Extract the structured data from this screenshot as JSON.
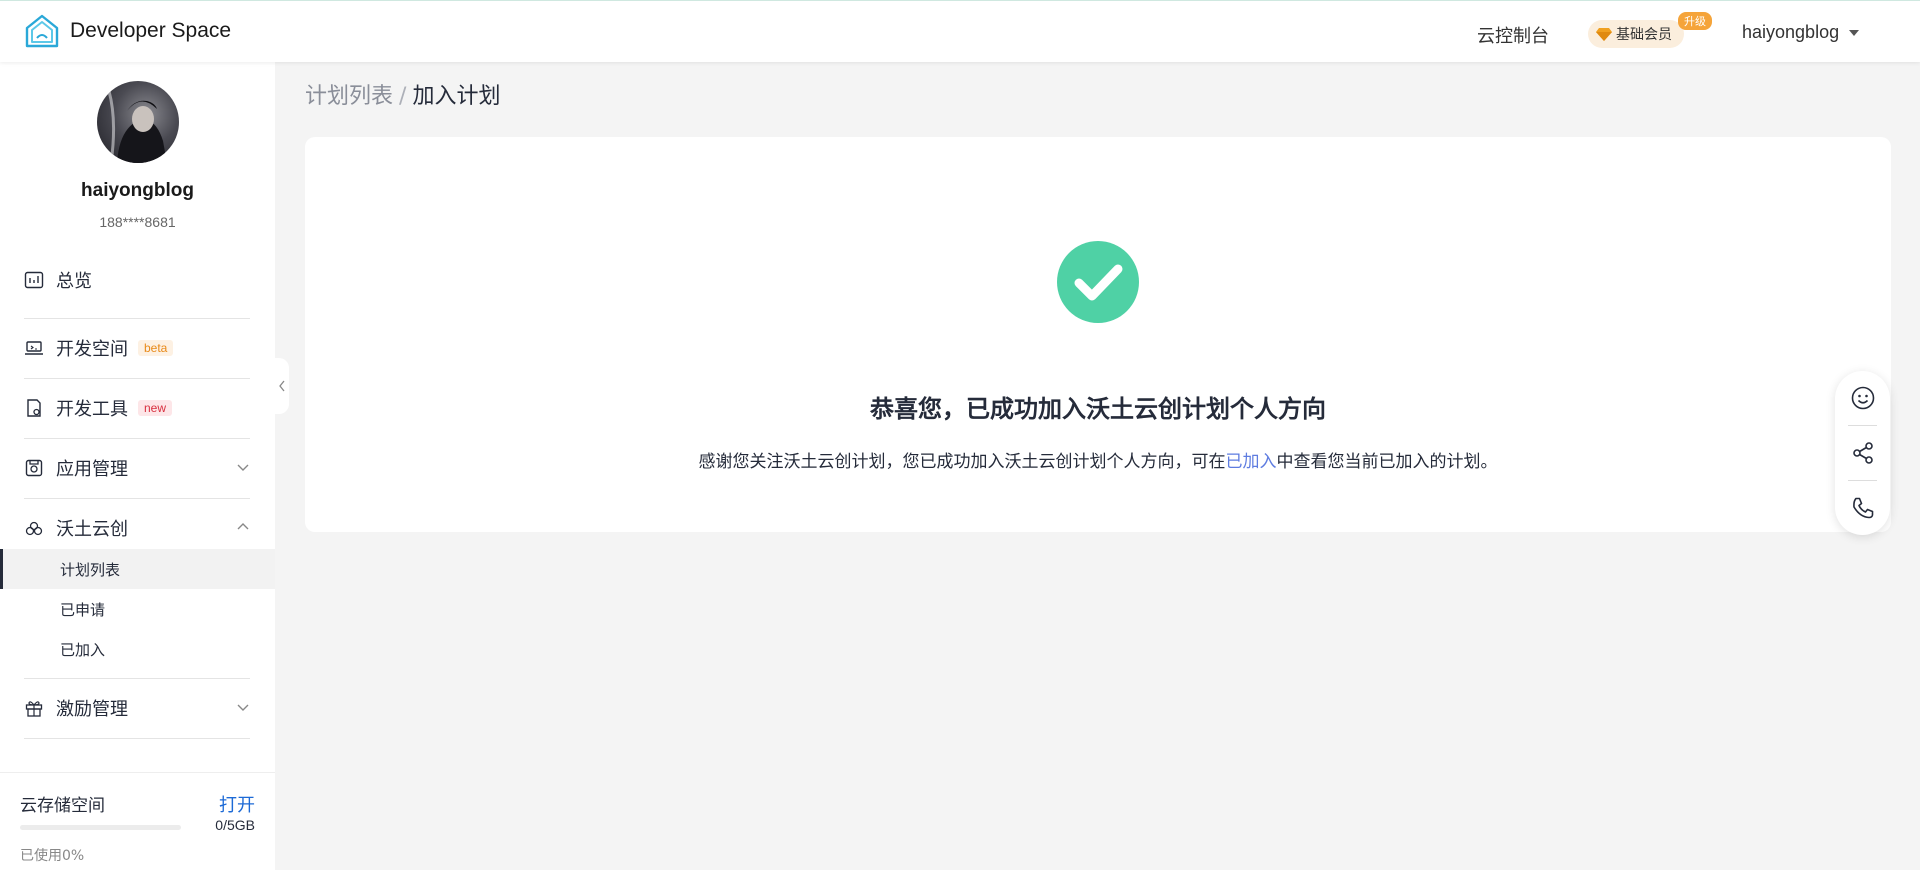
{
  "header": {
    "logo_text": "Developer Space",
    "console_label": "云控制台",
    "membership_label": "基础会员",
    "upgrade_badge": "升级",
    "username": "haiyongblog"
  },
  "sidebar": {
    "profile": {
      "name": "haiyongblog",
      "phone": "188****8681"
    },
    "items": {
      "overview": "总览",
      "dev_space": "开发空间",
      "dev_space_tag": "beta",
      "dev_tools": "开发工具",
      "dev_tools_tag": "new",
      "app_mgmt": "应用管理",
      "wotu": "沃土云创",
      "incentive": "激励管理"
    },
    "sub_items": {
      "plan_list": "计划列表",
      "applied": "已申请",
      "joined": "已加入"
    },
    "storage": {
      "title": "云存储空间",
      "open": "打开",
      "size": "0/5GB",
      "used": "已使用0%",
      "used_fraction": 0
    }
  },
  "breadcrumb": {
    "parent": "计划列表",
    "separator": "/",
    "current": "加入计划"
  },
  "result": {
    "title": "恭喜您，已成功加入沃土云创计划个人方向",
    "desc_before": "感谢您关注沃土云创计划，您已成功加入沃土云创计划个人方向，可在",
    "desc_link": "已加入",
    "desc_after": "中查看您当前已加入的计划。"
  },
  "colors": {
    "success": "#4fd1a5",
    "accent": "#5e7ce0",
    "link_blue": "#1d6ad6",
    "member_bg": "#fbeedd",
    "upgrade_badge": "#f5a43a"
  },
  "icons": {
    "logo": "house-logo-icon",
    "overview": "chart-icon",
    "dev_space": "laptop-icon",
    "dev_tools": "tool-doc-icon",
    "app_mgmt": "app-icon",
    "wotu": "cloud-icon",
    "incentive": "gift-icon",
    "float": [
      "smiley-icon",
      "share-icon",
      "phone-icon"
    ]
  }
}
